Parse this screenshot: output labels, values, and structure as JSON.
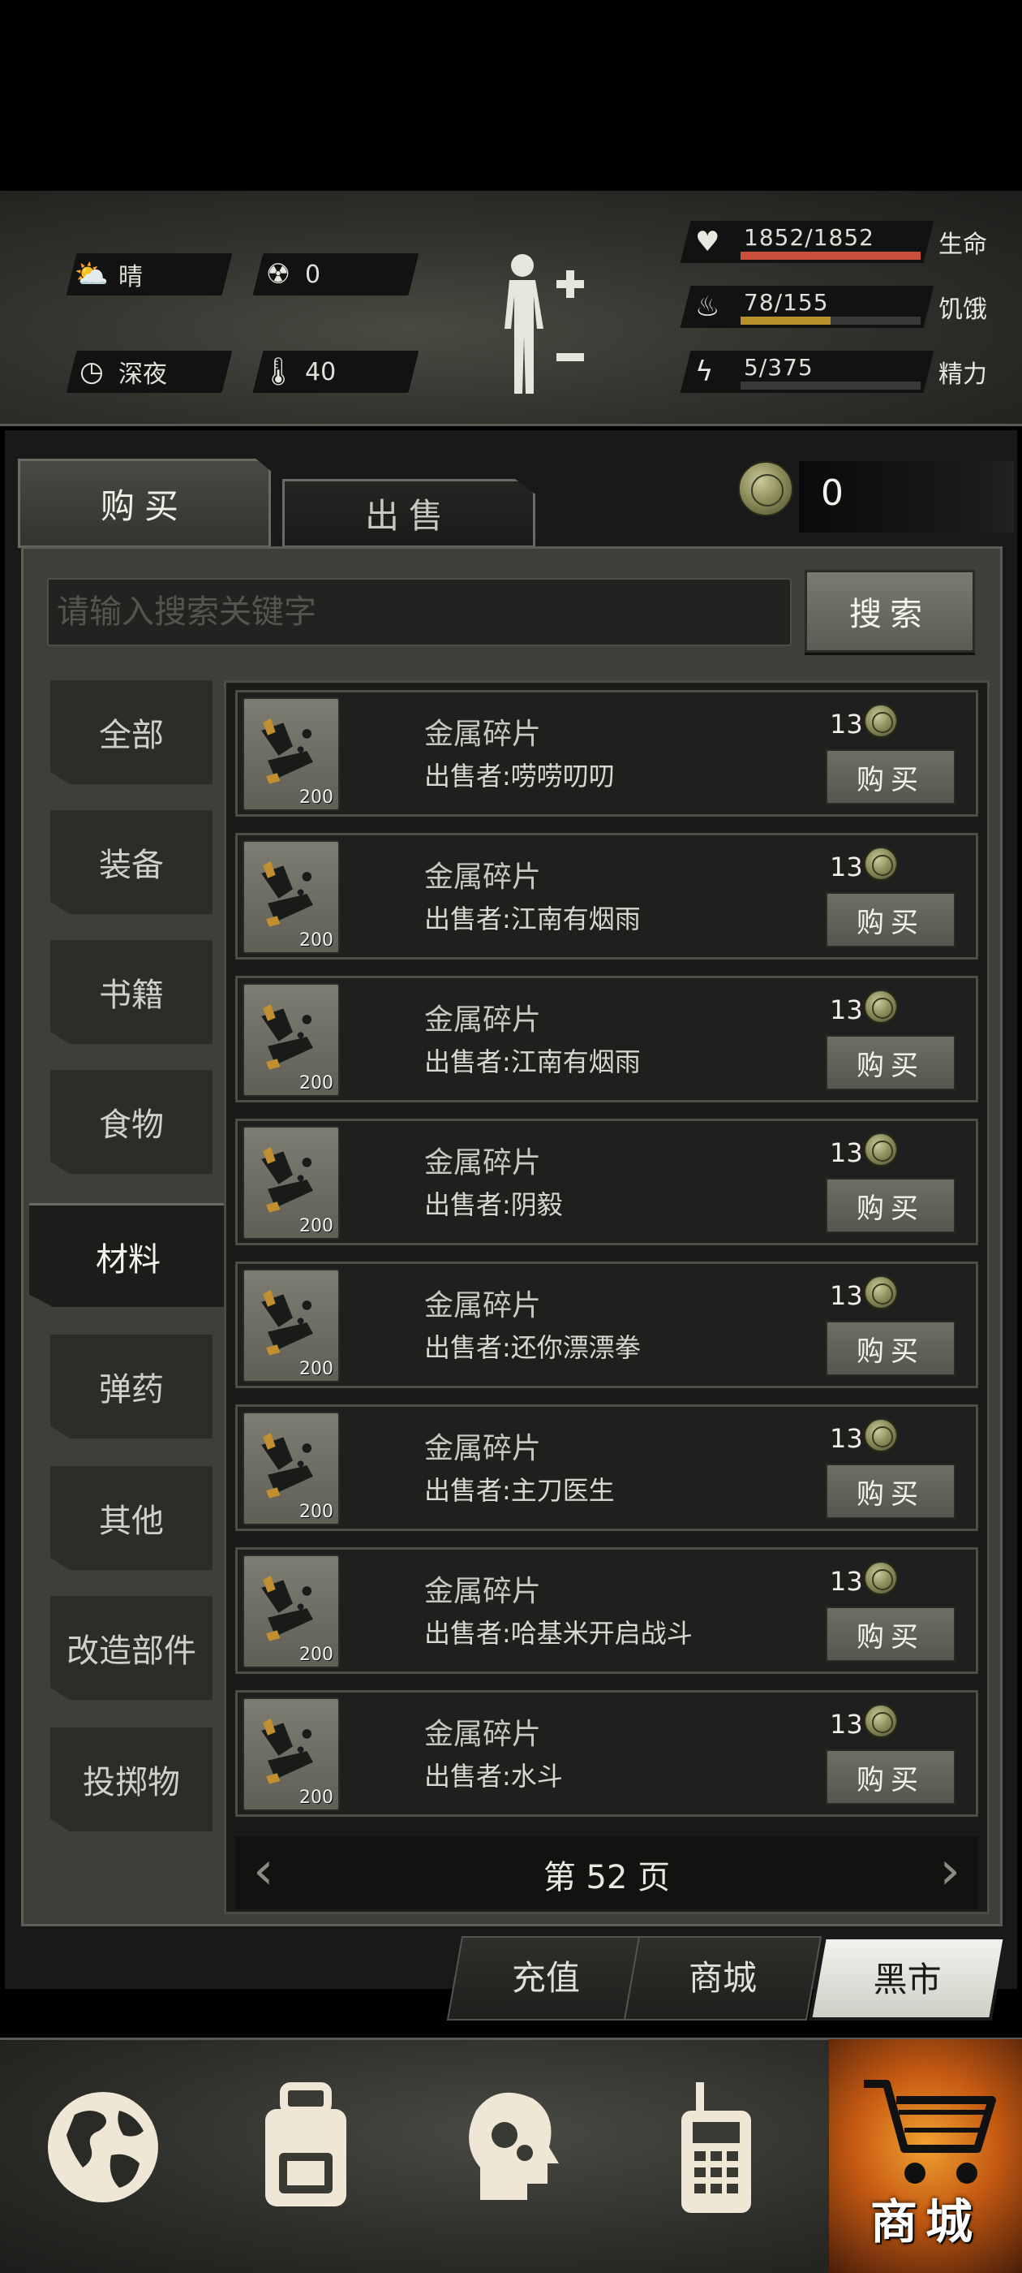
{
  "status": {
    "weather": "晴",
    "radiation": "0",
    "time_of_day": "深夜",
    "temperature": "40",
    "health": {
      "label": "生命",
      "value": "1852/1852",
      "fill": 1.0,
      "color": "#c8503c"
    },
    "hunger": {
      "label": "饥饿",
      "value": "78/155",
      "fill": 0.5,
      "color": "#b8902c"
    },
    "energy": {
      "label": "精力",
      "value": "5/375",
      "fill": 0.0,
      "color": "#8a8a82"
    }
  },
  "tabs": {
    "buy": "购买",
    "sell": "出售"
  },
  "balance": "0",
  "search": {
    "placeholder": "请输入搜索关键字",
    "button": "搜索"
  },
  "categories": [
    "全部",
    "装备",
    "书籍",
    "食物",
    "材料",
    "弹药",
    "其他",
    "改造部件",
    "投掷物"
  ],
  "active_category": "材料",
  "items": [
    {
      "name": "金属碎片",
      "seller": "出售者:唠唠叨叨",
      "price": "13",
      "qty": "200",
      "buy": "购买"
    },
    {
      "name": "金属碎片",
      "seller": "出售者:江南有烟雨",
      "price": "13",
      "qty": "200",
      "buy": "购买"
    },
    {
      "name": "金属碎片",
      "seller": "出售者:江南有烟雨",
      "price": "13",
      "qty": "200",
      "buy": "购买"
    },
    {
      "name": "金属碎片",
      "seller": "出售者:阴毅",
      "price": "13",
      "qty": "200",
      "buy": "购买"
    },
    {
      "name": "金属碎片",
      "seller": "出售者:还你漂漂拳",
      "price": "13",
      "qty": "200",
      "buy": "购买"
    },
    {
      "name": "金属碎片",
      "seller": "出售者:主刀医生",
      "price": "13",
      "qty": "200",
      "buy": "购买"
    },
    {
      "name": "金属碎片",
      "seller": "出售者:哈基米开启战斗",
      "price": "13",
      "qty": "200",
      "buy": "购买"
    },
    {
      "name": "金属碎片",
      "seller": "出售者:水斗",
      "price": "13",
      "qty": "200",
      "buy": "购买"
    }
  ],
  "pager": {
    "label": "第 52 页",
    "prev_icon": "chevron-left-icon",
    "next_icon": "chevron-right-icon"
  },
  "shop_tabs": [
    "充值",
    "商城",
    "黑市"
  ],
  "active_shop_tab": "黑市",
  "bottom_nav": {
    "icons": [
      "globe-icon",
      "backpack-icon",
      "head-gears-icon",
      "radio-icon",
      "cart-icon"
    ],
    "shop_label": "商城"
  }
}
